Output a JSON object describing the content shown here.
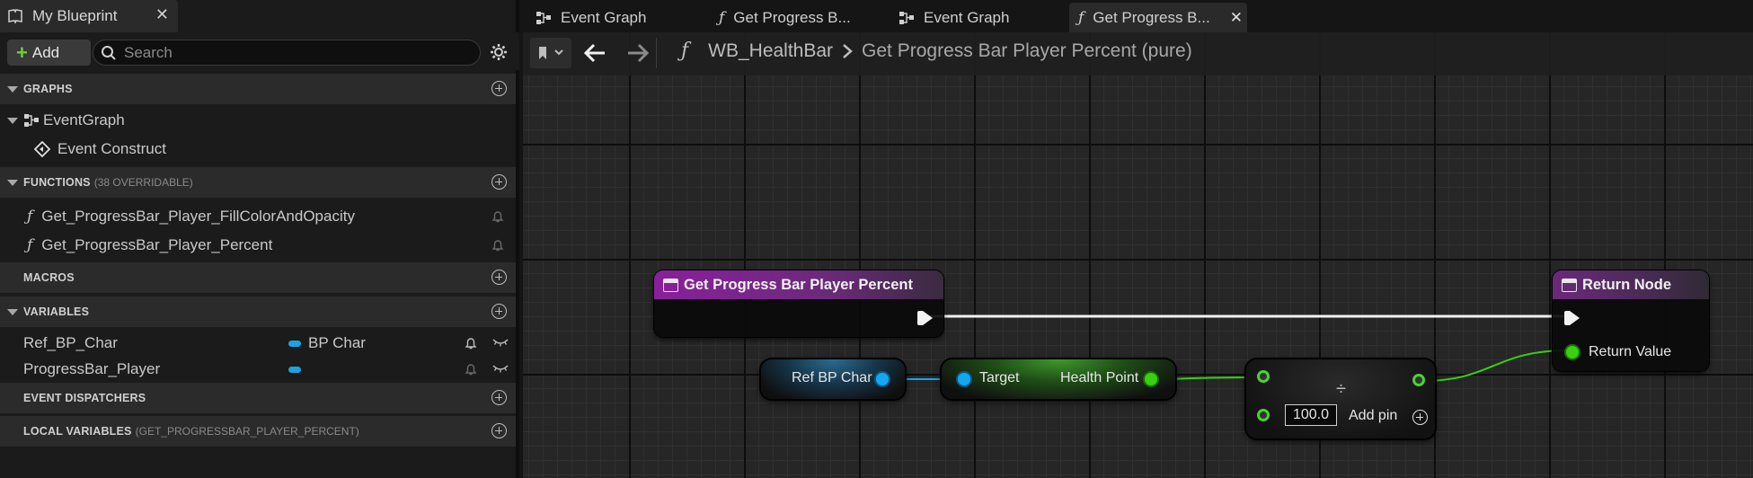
{
  "left_panel": {
    "tab_title": "My Blueprint",
    "add_label": "Add",
    "search_placeholder": "Search",
    "categories": {
      "graphs": "GRAPHS",
      "functions": "FUNCTIONS",
      "functions_sub": "(38 OVERRIDABLE)",
      "macros": "MACROS",
      "variables": "VARIABLES",
      "event_dispatchers": "EVENT DISPATCHERS",
      "local_variables": "LOCAL VARIABLES",
      "local_variables_sub": "(GET_PROGRESSBAR_PLAYER_PERCENT)"
    },
    "graphs": {
      "event_graph": "EventGraph",
      "event_construct": "Event Construct"
    },
    "functions": [
      "Get_ProgressBar_Player_FillColorAndOpacity",
      "Get_ProgressBar_Player_Percent"
    ],
    "variables": [
      {
        "name": "Ref_BP_Char",
        "type": "BP Char"
      },
      {
        "name": "ProgressBar_Player",
        "type": ""
      }
    ]
  },
  "tabs": [
    {
      "label": "Event Graph",
      "icon": "event-graph-icon"
    },
    {
      "label": "Get Progress B...",
      "icon": "function-icon"
    },
    {
      "label": "Event Graph",
      "icon": "event-graph-icon"
    },
    {
      "label": "Get Progress B...",
      "icon": "function-icon",
      "active": true
    }
  ],
  "breadcrumb": {
    "root": "WB_HealthBar",
    "current": "Get Progress Bar Player Percent (pure)"
  },
  "nodes": {
    "entry_title": "Get Progress Bar Player Percent",
    "return_title": "Return Node",
    "return_value": "Return Value",
    "ref_var": "Ref BP Char",
    "target": "Target",
    "health_point": "Health Point",
    "divide_value": "100.0",
    "add_pin": "Add pin",
    "divide_symbol": "÷"
  },
  "colors": {
    "function_purple": "#8a1f9c",
    "return_purple": "#6a2a7a",
    "float_green": "#38d10f",
    "object_blue": "#12a8f0"
  }
}
